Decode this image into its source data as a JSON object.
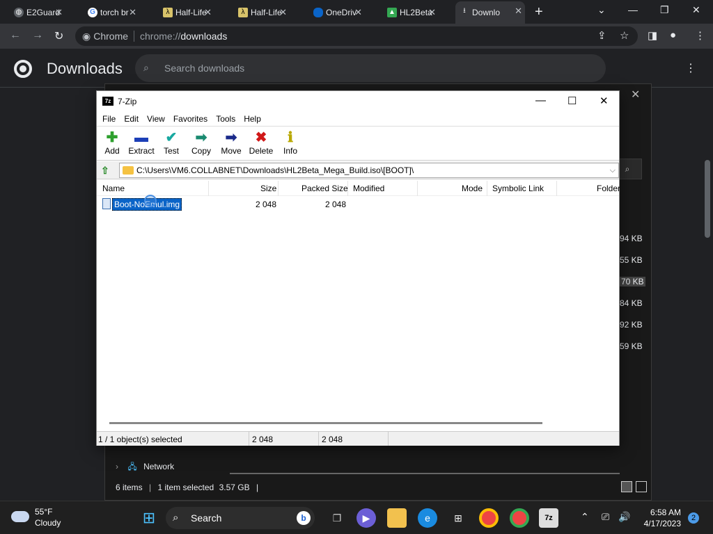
{
  "browser": {
    "tabs": [
      {
        "label": "E2Guard",
        "fav": "globe-icon"
      },
      {
        "label": "torch br",
        "fav": "google-icon"
      },
      {
        "label": "Half-Life",
        "fav": "lambda-icon"
      },
      {
        "label": "Half-Life",
        "fav": "lambda-icon"
      },
      {
        "label": "OneDriv",
        "fav": "onedrive-icon"
      },
      {
        "label": "HL2Beta",
        "fav": "drive-icon"
      },
      {
        "label": "Downlo",
        "fav": "download-icon"
      }
    ],
    "omnibox": {
      "chip": "Chrome",
      "url_prefix": "chrome://",
      "url_main": "downloads"
    }
  },
  "downloads": {
    "title": "Downloads",
    "search_placeholder": "Search downloads",
    "sizes": [
      "94 KB",
      "55 KB",
      "70 KB",
      "84 KB",
      "92 KB",
      "59 KB"
    ]
  },
  "explorer": {
    "nav_item": "Network",
    "status_items": "6 items",
    "status_selected": "1 item selected",
    "status_size": "3.57 GB"
  },
  "zip": {
    "title": "7-Zip",
    "icon_text": "7z",
    "menu": [
      "File",
      "Edit",
      "View",
      "Favorites",
      "Tools",
      "Help"
    ],
    "toolbar": [
      "Add",
      "Extract",
      "Test",
      "Copy",
      "Move",
      "Delete",
      "Info"
    ],
    "path": "C:\\Users\\VM6.COLLABNET\\Downloads\\HL2Beta_Mega_Build.iso\\[BOOT]\\",
    "columns": [
      "Name",
      "Size",
      "Packed Size",
      "Modified",
      "Mode",
      "Symbolic Link",
      "Folder"
    ],
    "row": {
      "name": "Boot-NoEmul.img",
      "size": "2 048",
      "packed": "2 048"
    },
    "status": {
      "selected": "1 / 1 object(s) selected",
      "size": "2 048",
      "packed": "2 048"
    }
  },
  "taskbar": {
    "temp": "55°F",
    "condition": "Cloudy",
    "search": "Search",
    "time": "6:58 AM",
    "date": "4/17/2023",
    "notifications": "2"
  },
  "colors": {
    "accent": "#0a64c8",
    "chrome_bg": "#202124",
    "zip_bg": "#ffffff"
  }
}
